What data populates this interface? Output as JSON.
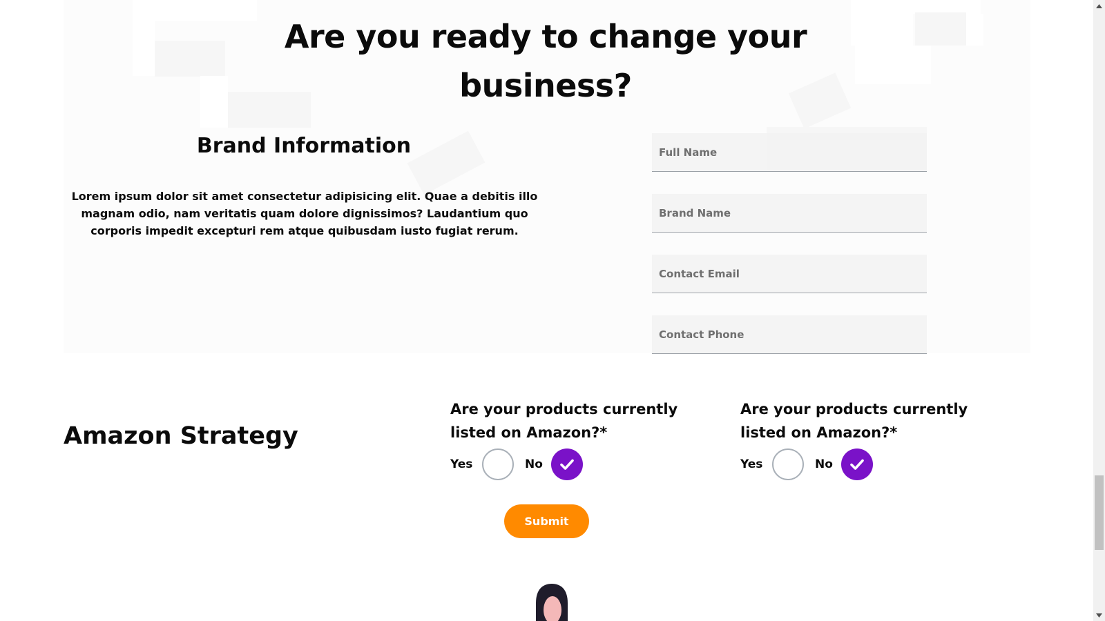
{
  "headline": "Are you ready to change your business?",
  "brand": {
    "title": "Brand Information",
    "description": "Lorem ipsum dolor sit amet consectetur adipisicing elit. Quae a debitis illo magnam odio, nam veritatis quam dolore dignissimos? Laudantium quo corporis impedit excepturi rem atque quibusdam iusto fugiat rerum."
  },
  "form": {
    "full_name_placeholder": "Full Name",
    "brand_name_placeholder": "Brand Name",
    "contact_email_placeholder": "Contact Email",
    "contact_phone_placeholder": "Contact Phone"
  },
  "strategy": {
    "title": "Amazon Strategy",
    "questions": [
      {
        "text": "Are your products currently listed on Amazon?*",
        "yes_label": "Yes",
        "no_label": "No",
        "selected": "No"
      },
      {
        "text": "Are your products currently listed on Amazon?*",
        "yes_label": "Yes",
        "no_label": "No",
        "selected": "No"
      }
    ]
  },
  "submit_label": "Submit",
  "colors": {
    "accent_purple": "#7a12c8",
    "submit_orange": "#ff8a00",
    "text": "#0b0b0b"
  }
}
